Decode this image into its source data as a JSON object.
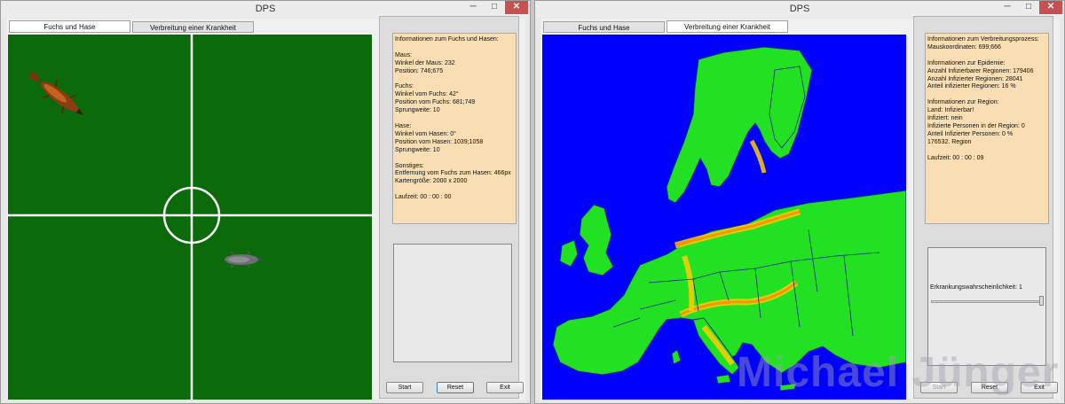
{
  "colors": {
    "field_green": "#0b6b0b",
    "sea_blue": "#0000ff",
    "land_green": "#22e022",
    "info_bg": "#f9deb3",
    "close_red": "#c75050"
  },
  "left_window": {
    "title": "DPS",
    "controls": {
      "minimize": "─",
      "maximize": "□",
      "close": "✕"
    },
    "tabs": [
      "Fuchs und Hase",
      "Verbreitung einer Krankheit"
    ],
    "active_tab": 0,
    "info_text": "Informationen zum Fuchs und Hasen:\n\nMaus:\nWinkel der Maus: 232\nPosition: 746;675\n\nFuchs:\nWinkel vom Fuchs: 42°\nPosition vom Fuchs: 681;749\nSprungweite: 10\n\nHase:\nWinkel vom Hasen: 0°\nPosition vom Hasen: 1039;1058\nSprungweite: 10\n\nSonstiges:\nEntfernung vom Fuchs zum Hasen: 466px\nKartengröße: 2000 x 2000\n\nLaufzeit: 00 : 00 : 00",
    "buttons": {
      "start": "Start",
      "reset": "Reset",
      "exit": "Exit"
    }
  },
  "right_window": {
    "title": "DPS",
    "controls": {
      "minimize": "─",
      "maximize": "□",
      "close": "✕"
    },
    "tabs": [
      "Fuchs und Hase",
      "Verbreitung einer Krankheit"
    ],
    "active_tab": 1,
    "info_text": "Informationen zum Verbreitungsprozess:\nMauskoordinaten: 699;666\n\nInformationen zur Epidemie:\nAnzahl Infizierbarer Regionen: 179406\nAnzahl Infizierter Regionen: 28041\nAnteil infizierter Regionen: 16 %\n\nInformationen zur Region:\nLand: Infizierbar!\nInfiziert: nein\nInfizierte Personen in der Region: 0\nAnteil Infizierter Personen: 0 %\n176532. Region\n\nLaufzeit: 00 : 00 : 09",
    "slider_label": "Erkrankungswahrscheinlichkeit: 1",
    "slider_value": 1.0,
    "buttons": {
      "start": "Start",
      "reset": "Reset",
      "exit": "Exit"
    }
  },
  "watermark": "Michael Jünger"
}
